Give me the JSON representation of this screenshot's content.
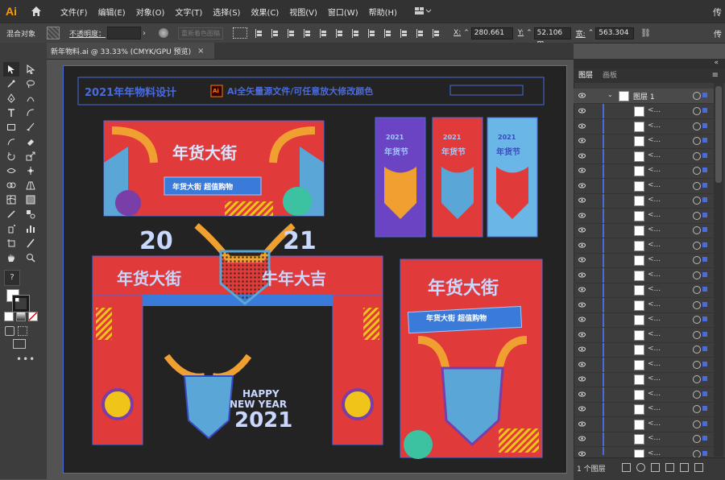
{
  "menubar": {
    "app_icon": "Ai",
    "items": [
      "文件(F)",
      "编辑(E)",
      "对象(O)",
      "文字(T)",
      "选择(S)",
      "效果(C)",
      "视图(V)",
      "窗口(W)",
      "帮助(H)"
    ],
    "right_text": "传"
  },
  "options": {
    "mixed_objects": "混合对象",
    "opacity_label": "不透明度：",
    "recolor_label": "重新着色图稿",
    "x_label": "X:",
    "x_value": "280.661",
    "y_label": "Y:",
    "y_value": "52.106 m",
    "w_label": "宽:",
    "w_value": "563.304",
    "right_more": "传"
  },
  "document_tab": {
    "title": "新年物料.ai @ 33.33% (CMYK/GPU 预览)",
    "close": "×"
  },
  "artwork": {
    "header_text": "2021年年物料设计",
    "ai_badge": "Ai",
    "header_note": "Ai全矢量源文件/可任意放大修改颜色",
    "banner_title": "年货大街",
    "banner_sub": "年货大街 超值购物",
    "arch_left_year": "20",
    "arch_right_year": "21",
    "arch_left_text": "年货大街",
    "arch_right_text": "牛年大吉",
    "happy": "HAPPY",
    "new_year": "NEW YEAR",
    "year_big": "2021",
    "poster_title": "年货大街",
    "poster_sub": "年货大街 超值购物",
    "vert_year": "2021",
    "vert_text": "年货节"
  },
  "layers_panel": {
    "tab_layers": "图层",
    "tab_artboards": "画板",
    "layer_name": "图层 1",
    "sub_label": "<...",
    "footer": "1 个图层",
    "colors": {
      "selection": "#4a6bdc",
      "panel": "#3d3d3d"
    }
  }
}
